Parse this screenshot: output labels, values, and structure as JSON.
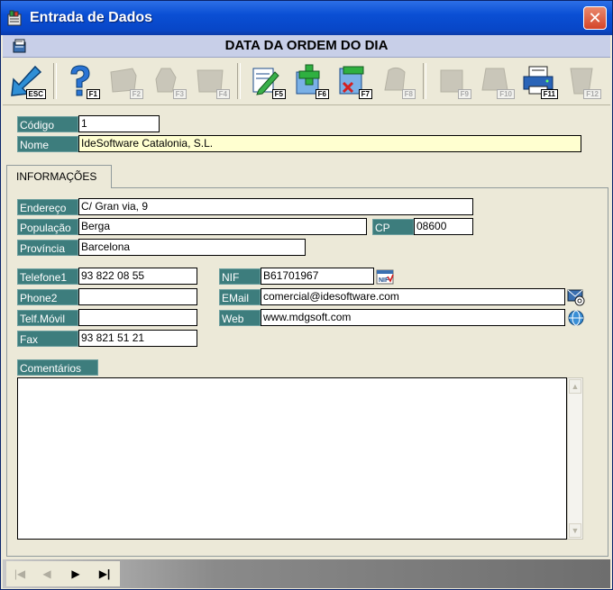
{
  "window": {
    "title": "Entrada de Dados"
  },
  "header": {
    "title": "DATA DA ORDEM DO DIA"
  },
  "toolbar": {
    "keys": [
      "ESC",
      "F1",
      "F2",
      "F3",
      "F4",
      "F5",
      "F6",
      "F7",
      "F8",
      "F9",
      "F10",
      "F11",
      "F12"
    ]
  },
  "top_fields": {
    "codigo_label": "Código",
    "codigo_value": "1",
    "nome_label": "Nome",
    "nome_value": "IdeSoftware Catalonia, S.L."
  },
  "tabs": [
    {
      "label": "INFORMAÇÕES"
    }
  ],
  "address": {
    "endereco_label": "Endereço",
    "endereco_value": "C/ Gran via, 9",
    "populacao_label": "População",
    "populacao_value": "Berga",
    "cp_label": "CP",
    "cp_value": "08600",
    "provincia_label": "Província",
    "provincia_value": "Barcelona"
  },
  "contact": {
    "telefone1_label": "Telefone1",
    "telefone1_value": "93 822 08 55",
    "phone2_label": "Phone2",
    "phone2_value": "",
    "movil_label": "Telf.Móvil",
    "movil_value": "",
    "fax_label": "Fax",
    "fax_value": "93 821 51 21",
    "nif_label": "NIF",
    "nif_value": "B61701967",
    "email_label": "EMail",
    "email_value": "comercial@idesoftware.com",
    "web_label": "Web",
    "web_value": "www.mdgsoft.com"
  },
  "comments": {
    "label": "Comentários",
    "value": ""
  },
  "navigator": {
    "first": "|◀",
    "prev": "◀",
    "next": "▶",
    "last": "▶|"
  },
  "icons": {
    "nif_badge": "NIF",
    "colors": {
      "title_bar": "#0a4fd4",
      "label_bg": "#3d7d7d",
      "field_highlight": "#ffffd0",
      "close": "#d4452a"
    }
  }
}
